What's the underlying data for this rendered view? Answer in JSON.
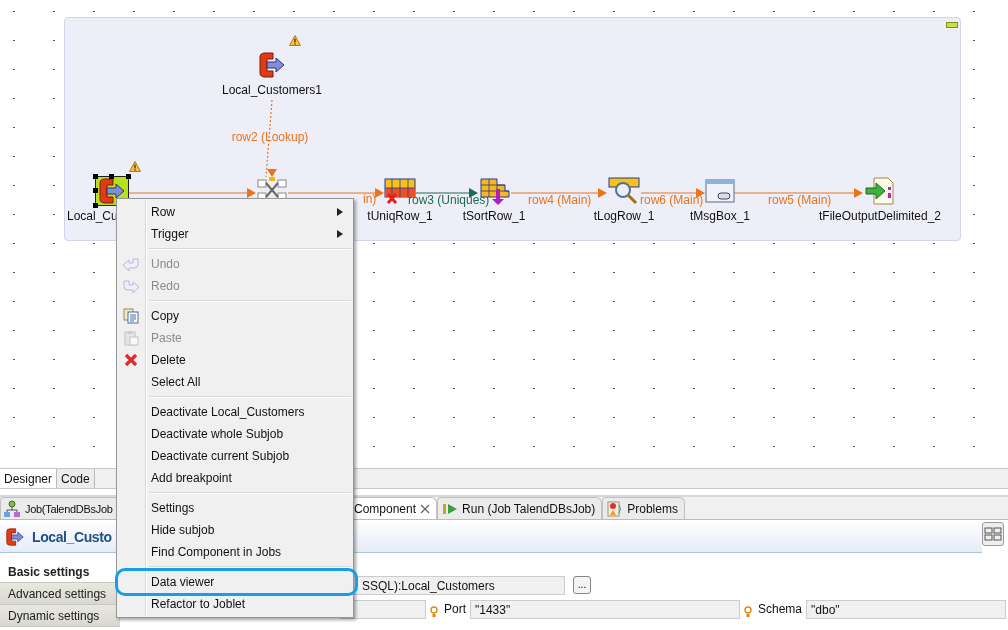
{
  "canvas": {
    "collapse_button": true,
    "nodes": [
      {
        "kind": "db-input",
        "label": "Local_Customers1",
        "warning": true,
        "selected": false
      },
      {
        "kind": "db-input",
        "label": "Local_Cu",
        "warning": true,
        "selected": true
      },
      {
        "kind": "map",
        "warning": false,
        "selected": false
      },
      {
        "kind": "uniq",
        "label": "tUniqRow_1",
        "warning": false,
        "selected": false
      },
      {
        "kind": "sort",
        "label": "tSortRow_1",
        "warning": false,
        "selected": false
      },
      {
        "kind": "log",
        "label": "tLogRow_1",
        "warning": false,
        "selected": false
      },
      {
        "kind": "msgbox",
        "label": "tMsgBox_1",
        "warning": false,
        "selected": false
      },
      {
        "kind": "file-output",
        "label": "tFileOutputDelimited_2",
        "warning": false,
        "selected": false
      }
    ],
    "links": [
      {
        "kind": "lookup",
        "label": "row2 (Lookup)"
      },
      {
        "kind": "main"
      },
      {
        "kind": "main",
        "label": "in)"
      },
      {
        "kind": "uniques",
        "label": "row3 (Uniques)"
      },
      {
        "kind": "main",
        "label": "row4 (Main)"
      },
      {
        "kind": "main",
        "label": "row6 (Main)"
      },
      {
        "kind": "main",
        "label": "row5 (Main)"
      }
    ]
  },
  "editor_tabs": [
    {
      "label": "Designer",
      "selected": true
    },
    {
      "label": "Code",
      "selected": false
    }
  ],
  "panel_tabs": [
    {
      "kind": "job",
      "label": "Job(TalendDBsJob",
      "selected": false,
      "closable": false
    },
    {
      "kind": "component",
      "label": "Component",
      "selected": true,
      "closable": true
    },
    {
      "kind": "run",
      "label": "Run (Job TalendDBsJob)",
      "selected": false,
      "closable": false
    },
    {
      "kind": "problems",
      "label": "Problems",
      "selected": false,
      "closable": false
    }
  ],
  "component_title": "Local_Custo",
  "settings_tabs": [
    {
      "label": "Basic settings",
      "selected": true
    },
    {
      "label": "Advanced settings",
      "selected": false
    },
    {
      "label": "Dynamic settings",
      "selected": false
    }
  ],
  "form_rows": [
    [
      {
        "kind": "field",
        "value": "SSQL):Local_Customers"
      },
      {
        "kind": "browse",
        "label": "..."
      }
    ],
    [
      {
        "kind": "field",
        "hint": true
      },
      {
        "kind": "field",
        "label": "Port",
        "value": "\"1433\"",
        "hint": true
      },
      {
        "kind": "field",
        "label": "Schema",
        "value": "\"dbo\""
      }
    ]
  ],
  "context_menu": [
    {
      "kind": "item",
      "label": "Row",
      "submenu": true,
      "disabled": false
    },
    {
      "kind": "item",
      "label": "Trigger",
      "submenu": true,
      "disabled": false
    },
    {
      "kind": "separator"
    },
    {
      "kind": "undo",
      "label": "Undo",
      "disabled": true
    },
    {
      "kind": "redo",
      "label": "Redo",
      "disabled": true
    },
    {
      "kind": "separator"
    },
    {
      "kind": "copy",
      "label": "Copy",
      "disabled": false
    },
    {
      "kind": "paste",
      "label": "Paste",
      "disabled": true
    },
    {
      "kind": "delete",
      "label": "Delete",
      "disabled": false
    },
    {
      "kind": "item",
      "label": "Select All",
      "disabled": false
    },
    {
      "kind": "separator"
    },
    {
      "kind": "item",
      "label": "Deactivate Local_Customers",
      "disabled": false
    },
    {
      "kind": "item",
      "label": "Deactivate whole Subjob",
      "disabled": false
    },
    {
      "kind": "item",
      "label": "Deactivate current Subjob",
      "disabled": false
    },
    {
      "kind": "item",
      "label": "Add breakpoint",
      "disabled": false
    },
    {
      "kind": "separator"
    },
    {
      "kind": "item",
      "label": "Settings",
      "disabled": false
    },
    {
      "kind": "item",
      "label": "Hide subjob",
      "disabled": false
    },
    {
      "kind": "item",
      "label": "Find Component in Jobs",
      "disabled": false
    },
    {
      "kind": "separator"
    },
    {
      "kind": "item",
      "label": "Data viewer",
      "disabled": false,
      "circled": true
    },
    {
      "kind": "item",
      "label": "Refactor to Joblet",
      "disabled": false
    }
  ]
}
